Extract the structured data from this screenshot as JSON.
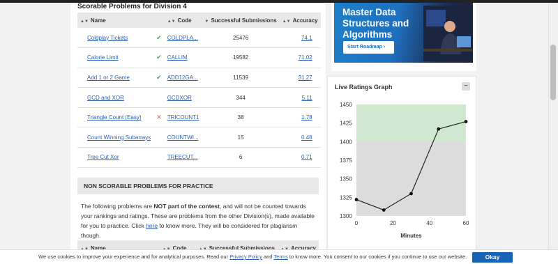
{
  "section_title": "Scorable Problems for Division 4",
  "table": {
    "headers": {
      "name": "Name",
      "code": "Code",
      "subs": "Successful Submissions",
      "acc": "Accuracy"
    },
    "rows": [
      {
        "name": "Coldplay Tickets",
        "status": "solved",
        "code": "COLDPLA...",
        "subs": "25476",
        "acc": "74.1"
      },
      {
        "name": "Calorie Limit",
        "status": "solved",
        "code": "CALLIM",
        "subs": "19582",
        "acc": "71.02"
      },
      {
        "name": "Add 1 or 2 Game",
        "status": "solved",
        "code": "ADD12GA...",
        "subs": "11539",
        "acc": "31.27"
      },
      {
        "name": "GCD and XOR",
        "status": "none",
        "code": "GCDXOR",
        "subs": "344",
        "acc": "5.11"
      },
      {
        "name": "Triangle Count (Easy)",
        "status": "wrong",
        "code": "TRICOUNT1",
        "subs": "38",
        "acc": "1.78"
      },
      {
        "name": "Count Winning Subarrays",
        "status": "none",
        "code": "COUNTWI...",
        "subs": "15",
        "acc": "0.48"
      },
      {
        "name": "Tree Cut Xor",
        "status": "none",
        "code": "TREECUT...",
        "subs": "6",
        "acc": "0.71"
      }
    ]
  },
  "nonscorable": {
    "title": "NON SCORABLE PROBLEMS FOR PRACTICE",
    "text_a": "The following problems are ",
    "text_b": "NOT part of the contest",
    "text_c": ", and will not be counted towards your rankings and ratings. These are problems from the other Division(s), made available for you to practice. Click ",
    "link": "here",
    "text_d": " to know more. They will be considered for plagiarism though.",
    "headers": {
      "name": "Name",
      "code": "Code",
      "subs": "Successful Submissions",
      "acc": "Accuracy"
    }
  },
  "banner": {
    "title": "Master Data Structures and Algorithms",
    "button": "Start Roadmap"
  },
  "graph": {
    "title": "Live Ratings Graph",
    "collapse": "−",
    "xlabel": "Minutes"
  },
  "chart_data": {
    "type": "line",
    "x": [
      0,
      15,
      30,
      45,
      60
    ],
    "y": [
      1322,
      1308,
      1330,
      1417,
      1427
    ],
    "xlabel": "Minutes",
    "ylabel": "",
    "xlim": [
      0,
      60
    ],
    "ylim": [
      1300,
      1450
    ],
    "xticks": [
      0,
      20,
      40,
      60
    ],
    "yticks": [
      1300,
      1325,
      1350,
      1375,
      1400,
      1425,
      1450
    ],
    "bands": [
      {
        "from": 1400,
        "to": 1450,
        "color": "#cfe8cf"
      },
      {
        "from": 1300,
        "to": 1400,
        "color": "#dcdcdc"
      }
    ]
  },
  "cookie": {
    "text_a": "We use cookies to improve your experience and for analytical purposes. Read our ",
    "privacy": "Privacy Policy",
    "text_b": " and ",
    "terms": "Terms",
    "text_c": " to know more. You consent to our cookies if you continue to use our website.",
    "okay": "Okay"
  },
  "colors": {
    "link": "#2a5db0",
    "solved": "#3fa54a",
    "wrong": "#e05a5a",
    "okay_btn": "#1863b5"
  }
}
